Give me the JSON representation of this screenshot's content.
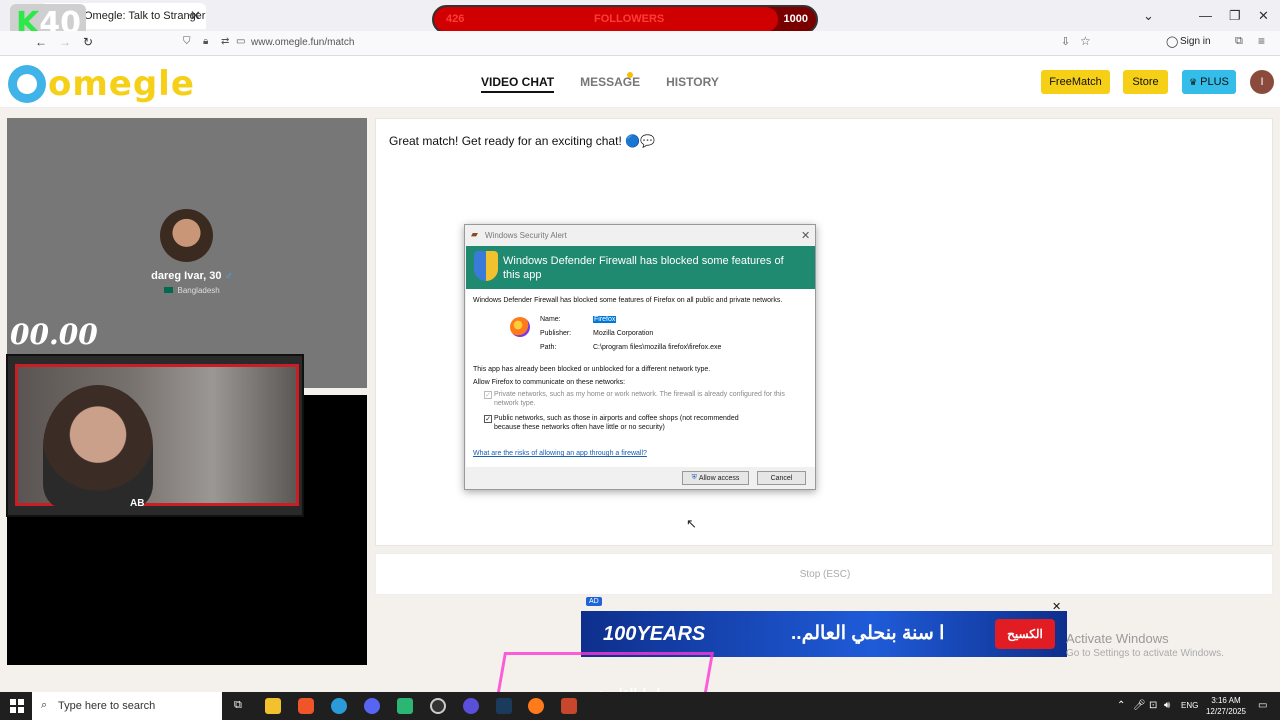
{
  "browser": {
    "tab_title": "Omegle: Talk to Strangers »",
    "url": "www.omegle.fun/match",
    "sign_in": "Sign in"
  },
  "stream_overlay": {
    "badge_letter": "K",
    "badge_number": "40",
    "followers_label": "FOLLOWERS",
    "followers_current": "426",
    "followers_goal": "1000",
    "followers_progress": 0.9
  },
  "header": {
    "logo": "omegle",
    "nav": [
      "VIDEO CHAT",
      "MESSAGE",
      "HISTORY"
    ],
    "buttons": {
      "freematch": "FreeMatch",
      "store": "Store",
      "plus": "PLUS"
    },
    "avatar_letter": "I",
    "colors": {
      "brand_yellow": "#f6cf17",
      "brand_blue": "#40b4e8",
      "plus_bg": "#33bde8"
    }
  },
  "peer": {
    "name": "dareg Ivar, 30",
    "country": "Bangladesh",
    "timer": "00.00"
  },
  "webcam": {
    "tag": "AB"
  },
  "chat": {
    "message": "Great match! Get ready for an exciting chat! 🔵💬",
    "stop_label": "Stop (ESC)"
  },
  "dialog": {
    "title": "Windows Security Alert",
    "heading": "Windows Defender Firewall has blocked some features of this app",
    "intro": "Windows Defender Firewall has blocked some features of Firefox on all public and private networks.",
    "name_label": "Name:",
    "name_value": "Firefox",
    "publisher_label": "Publisher:",
    "publisher_value": "Mozilla Corporation",
    "path_label": "Path:",
    "path_value": "C:\\program files\\mozilla firefox\\firefox.exe",
    "already_blocked": "This app has already been blocked or unblocked for a different network type.",
    "allow_prompt": "Allow Firefox to communicate on these networks:",
    "private_option": "Private networks, such as my home or work network. The firewall is already configured for this network type.",
    "public_option": "Public networks, such as those in airports and coffee shops (not recommended because these networks often have little or no security)",
    "risk_link": "What are the risks of allowing an app through a firewall?",
    "allow_button": "Allow access",
    "cancel_button": "Cancel"
  },
  "ad": {
    "badge": "AD",
    "years": "100YEARS",
    "arabic": "..ا سنة بنحلي العالم",
    "brand": "الكسيح"
  },
  "activation": {
    "title": "Activate Windows",
    "subtitle": "Go to Settings to activate Windows."
  },
  "overlay_text": "رابط القاهرة",
  "taskbar": {
    "search_placeholder": "Type here to search",
    "lang": "ENG",
    "time": "3:16 AM",
    "date": "12/27/2025"
  }
}
